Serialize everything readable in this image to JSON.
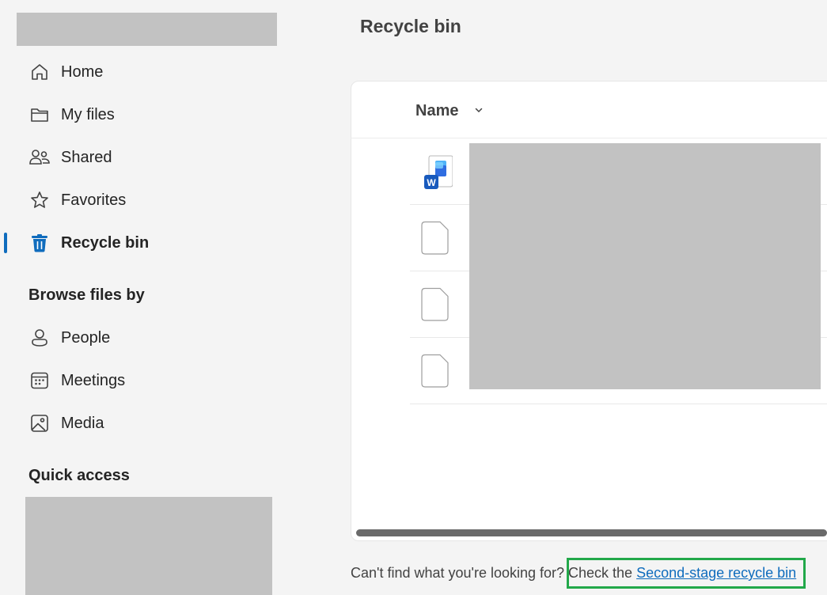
{
  "sidebar": {
    "nav": [
      {
        "label": "Home",
        "icon": "home-icon"
      },
      {
        "label": "My files",
        "icon": "folder-icon"
      },
      {
        "label": "Shared",
        "icon": "people-icon"
      },
      {
        "label": "Favorites",
        "icon": "star-icon"
      },
      {
        "label": "Recycle bin",
        "icon": "trash-icon",
        "active": true
      }
    ],
    "browse_heading": "Browse files by",
    "browse": [
      {
        "label": "People",
        "icon": "person-icon"
      },
      {
        "label": "Meetings",
        "icon": "calendar-icon"
      },
      {
        "label": "Media",
        "icon": "image-icon"
      }
    ],
    "quick_access_heading": "Quick access"
  },
  "main": {
    "title": "Recycle bin",
    "column_name": "Name",
    "rows": [
      {
        "type": "word-document-icon"
      },
      {
        "type": "generic-file-icon"
      },
      {
        "type": "generic-file-icon"
      },
      {
        "type": "generic-file-icon"
      }
    ],
    "footer_text": "Can't find what you're looking for? Check the ",
    "footer_link": "Second-stage recycle bin"
  },
  "colors": {
    "accent": "#0f6cbd",
    "background": "#f4f4f4",
    "highlight": "#22a84a",
    "word_blue": "#185abd"
  }
}
